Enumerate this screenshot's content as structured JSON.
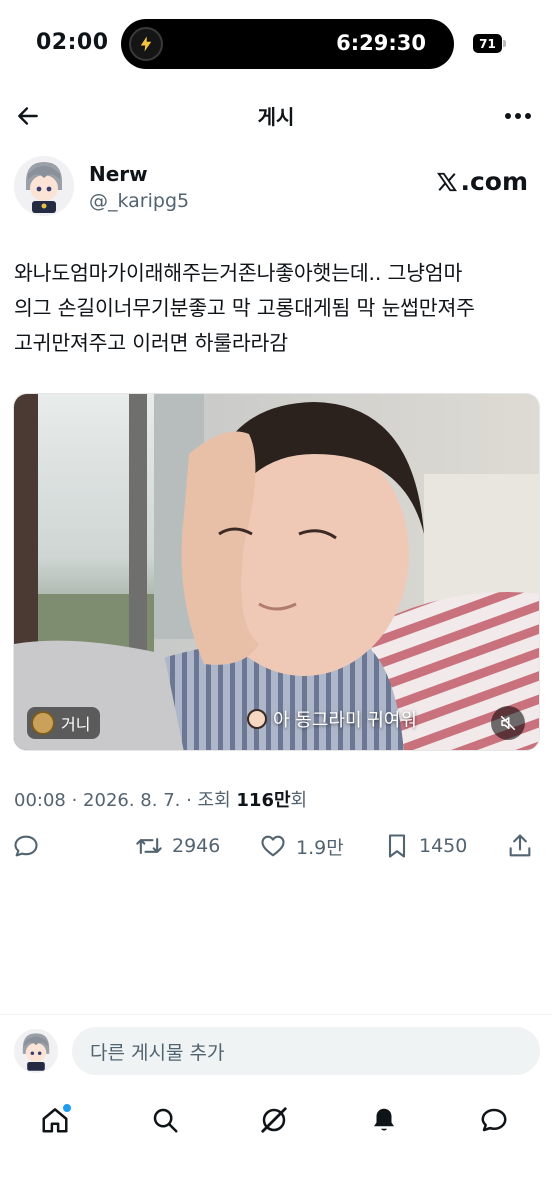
{
  "status_bar": {
    "time": "02:00",
    "activity_timer": "6:29:30",
    "battery_level": "71"
  },
  "header": {
    "title": "게시"
  },
  "post": {
    "author_name": "Nerw",
    "author_handle": "@_karipg5",
    "brand_suffix": ".com",
    "text_lines": [
      "와나도엄마가이래해주는거존나좋아햇는데.. 그냥엄마",
      "의그 손길이너무기분좋고 막 고롱대게됨 막 눈썹만져주",
      "고귀만져주고 이러면 하룰라라감"
    ],
    "media": {
      "creator_label": "거니",
      "caption": "아 동그라미 귀여워"
    },
    "meta": {
      "time": "00:08",
      "date": "2026. 8. 7.",
      "views_label": "조회",
      "views_number": "116",
      "views_unit": "만회"
    },
    "stats": {
      "reposts": "2946",
      "likes": "1.9만",
      "bookmarks": "1450"
    }
  },
  "reply_bar": {
    "placeholder": "다른 게시물 추가"
  },
  "colors": {
    "text": "#0f1419",
    "secondary": "#536471",
    "accent": "#1d9bf0"
  },
  "icons": [
    "back-arrow-icon",
    "more-icon",
    "x-logo-icon",
    "reply-icon",
    "repost-icon",
    "like-icon",
    "bookmark-icon",
    "share-icon",
    "home-icon",
    "search-icon",
    "grok-icon",
    "notifications-icon",
    "messages-icon",
    "muted-speaker-icon"
  ]
}
